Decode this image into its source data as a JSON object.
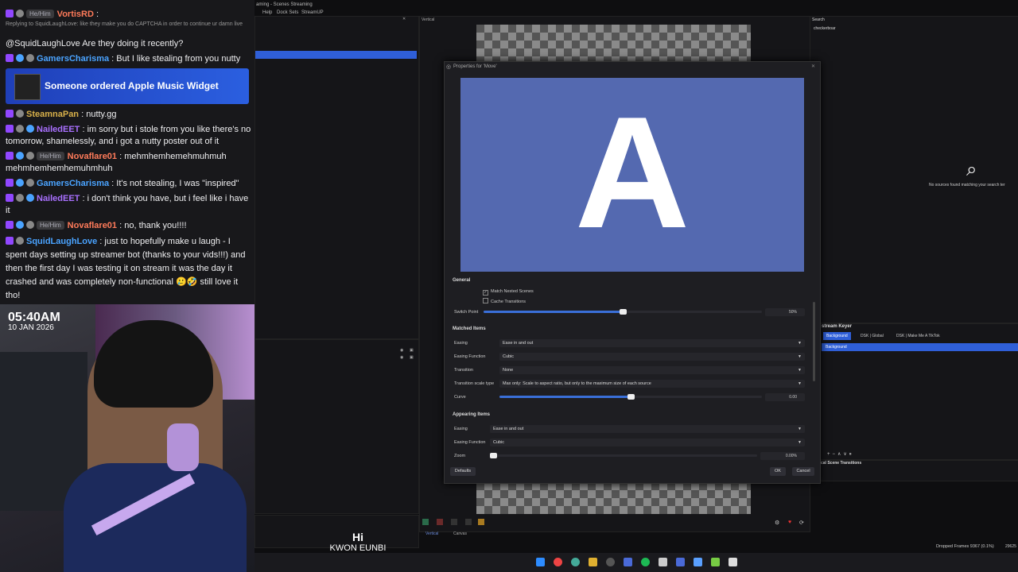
{
  "chat": {
    "messages": [
      {
        "badge": "",
        "user": "VortisRD",
        "text": ":"
      },
      {
        "reply": "Replying to SquidLaughLove: like they make you do CAPTCHA in order to continue ur damn live"
      },
      {
        "text": "@SquidLaughLove Are they doing it recently?"
      },
      {
        "user": "GamersCharisma",
        "text": ": But I like stealing from you nutty"
      },
      {
        "user": "SteamnaPan",
        "text": ": nutty.gg"
      },
      {
        "user": "NailedEET",
        "text": ": im sorry but i stole from you like there's no tomorrow, shamelessly, and i got a nutty poster out of it"
      },
      {
        "user": "Novaflare01",
        "text": ": mehmhemhemehmuhmuh mehmhemhemhemuhmhuh"
      },
      {
        "user": "GamersCharisma",
        "text": ": It's not stealing, I was \"inspired\""
      },
      {
        "user": "NailedEET",
        "text": ": i don't think you have, but i feel like i have it"
      },
      {
        "user": "Novaflare01",
        "text": ": no, thank you!!!!"
      },
      {
        "user": "SquidLaughLove",
        "text": ": just to hopefully make u laugh - I spent days setting up streamer bot (thanks to your vids!!!) and then the first day I was testing it on stream it was the day it crashed and was completely non-functional 🥲🤣 still love it tho!"
      }
    ],
    "pronoun": "He/Him",
    "alert": "Someone ordered Apple Music Widget"
  },
  "overlay": {
    "time": "05:40AM",
    "date": "10 JAN 2026",
    "caption_title": "Hi",
    "caption_sub": "KWON EUNBI"
  },
  "obs": {
    "window_title": "aming - Scenes Streaming",
    "menu": [
      "Help",
      "Dock Sets",
      "StreamUP"
    ],
    "vertical_label": "Vertical",
    "search_label": "Search",
    "search_value": "checkerboar",
    "no_sources": "No sources found matching your search ter",
    "downstream_title": "stream Keyer",
    "downstream_tabs": [
      "Background",
      "DSK | Global",
      "DSK | Make Me A TikTok"
    ],
    "downstream_item": "Background",
    "scene_transitions": "cal Scene Transitions",
    "bottom_tabs": [
      "Vertical",
      "Canvas"
    ],
    "status": "Dropped Frames 9367 (0.1%)",
    "status_extra": "29625"
  },
  "dialog": {
    "title": "Properties for 'Move'",
    "preview_letter": "A",
    "general": "General",
    "match_nested": "Match Nested Scenes",
    "cache_transitions": "Cache Transitions",
    "switch_point": "Switch Point",
    "switch_point_value": "50%",
    "switch_point_level": 0.5,
    "matched_items": "Matched Items",
    "easing_label": "Easing",
    "easing_value": "Ease in and out",
    "easing_function_label": "Easing Function",
    "easing_function_value": "Cubic",
    "transition_label": "Transition",
    "transition_value": "None",
    "scale_type_label": "Transition scale type",
    "scale_type_value": "Max only: Scale to aspect ratio, but only to the maximum size of each source",
    "curve_label": "Curve",
    "curve_value": "0.00",
    "curve_level": 0.5,
    "appearing_items": "Appearing Items",
    "a_easing_value": "Ease in and out",
    "a_easing_function_value": "Cubic",
    "zoom_label": "Zoom",
    "zoom_value": "0.00%",
    "zoom_level": 0.0,
    "defaults_btn": "Defaults",
    "ok_btn": "OK",
    "cancel_btn": "Cancel"
  },
  "colors": {
    "chat_bg": "#18181b",
    "alert": "#2b5fe0",
    "preview": "#5469b0",
    "accent": "#3a6fd8"
  }
}
